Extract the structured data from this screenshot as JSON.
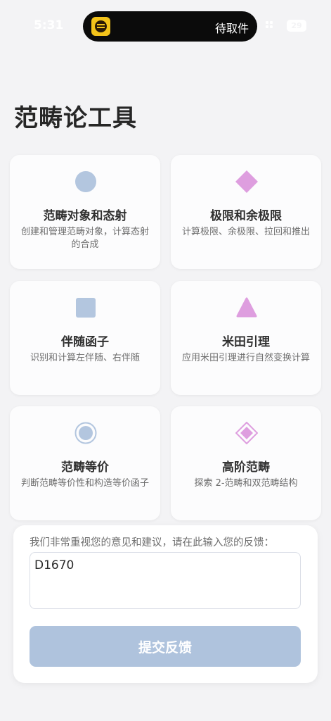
{
  "status_bar": {
    "time": "5:31",
    "island_text": "待取件",
    "battery": "29"
  },
  "page": {
    "title": "范畴论工具"
  },
  "cards": [
    {
      "title": "范畴对象和态射",
      "desc": "创建和管理范畴对象，计算态射的合成",
      "icon": "circle-icon",
      "color": "#b3c6df"
    },
    {
      "title": "极限和余极限",
      "desc": "计算极限、余极限、拉回和推出",
      "icon": "diamond-icon",
      "color": "#de9edf"
    },
    {
      "title": "伴随函子",
      "desc": "识别和计算左伴随、右伴随",
      "icon": "square-icon",
      "color": "#b3c6df"
    },
    {
      "title": "米田引理",
      "desc": "应用米田引理进行自然变换计算",
      "icon": "triangle-icon",
      "color": "#de9edf"
    },
    {
      "title": "范畴等价",
      "desc": "判断范畴等价性和构造等价函子",
      "icon": "ringed-circle-icon",
      "color": "#b3c6df"
    },
    {
      "title": "高阶范畴",
      "desc": "探索 2-范畴和双范畴结构",
      "icon": "framed-diamond-icon",
      "color": "#de9edf"
    }
  ],
  "feedback": {
    "prompt": "我们非常重视您的意见和建议，请在此输入您的反馈：",
    "value": "D1670",
    "submit_label": "提交反馈"
  }
}
